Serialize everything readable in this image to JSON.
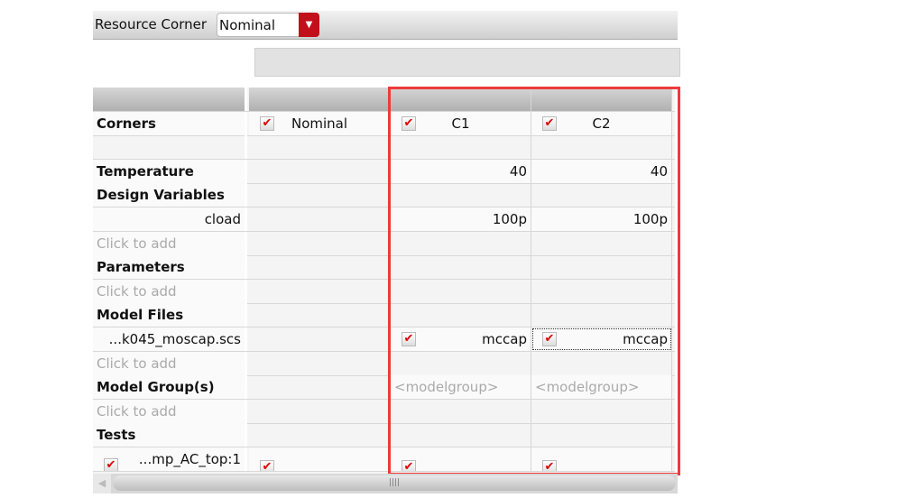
{
  "toolbar": {
    "resource_corner_label": "Resource Corner",
    "resource_corner_value": "Nominal"
  },
  "columns": [
    "",
    "Nominal",
    "C1",
    "C2"
  ],
  "rows": [
    {
      "label": "Corners",
      "kind": "corners",
      "cells": [
        "Nominal",
        "C1",
        "C2"
      ]
    },
    {
      "label": "",
      "kind": "blank",
      "cells": [
        "",
        "",
        ""
      ]
    },
    {
      "label": "Temperature",
      "kind": "section",
      "cells": [
        "",
        "40",
        "40"
      ]
    },
    {
      "label": "Design Variables",
      "kind": "section",
      "cells": [
        "",
        "",
        ""
      ]
    },
    {
      "label": "cload",
      "kind": "value",
      "cells": [
        "",
        "100p",
        "100p"
      ]
    },
    {
      "label": "Click to add",
      "kind": "hint",
      "cells": [
        "",
        "",
        ""
      ]
    },
    {
      "label": "Parameters",
      "kind": "section",
      "cells": [
        "",
        "",
        ""
      ]
    },
    {
      "label": "Click to add",
      "kind": "hint",
      "cells": [
        "",
        "",
        ""
      ]
    },
    {
      "label": "Model Files",
      "kind": "section",
      "cells": [
        "",
        "",
        ""
      ]
    },
    {
      "label": "...k045_moscap.scs",
      "kind": "model",
      "cells": [
        "",
        "mccap",
        "mccap"
      ]
    },
    {
      "label": "Click to add",
      "kind": "hint",
      "cells": [
        "",
        "",
        ""
      ]
    },
    {
      "label": "Model Group(s)",
      "kind": "section",
      "cells": [
        "",
        "<modelgroup>",
        "<modelgroup>"
      ]
    },
    {
      "label": "Click to add",
      "kind": "hint",
      "cells": [
        "",
        "",
        ""
      ]
    },
    {
      "label": "Tests",
      "kind": "section",
      "cells": [
        "",
        "",
        ""
      ]
    },
    {
      "label": "...mp_AC_top:1",
      "kind": "test",
      "cells": [
        "",
        "",
        ""
      ]
    }
  ],
  "icons": {
    "check": "checkmark-icon",
    "dropdown": "chevron-down-icon"
  },
  "colors": {
    "accent": "#c0101a",
    "highlight": "#ee3a3a"
  }
}
